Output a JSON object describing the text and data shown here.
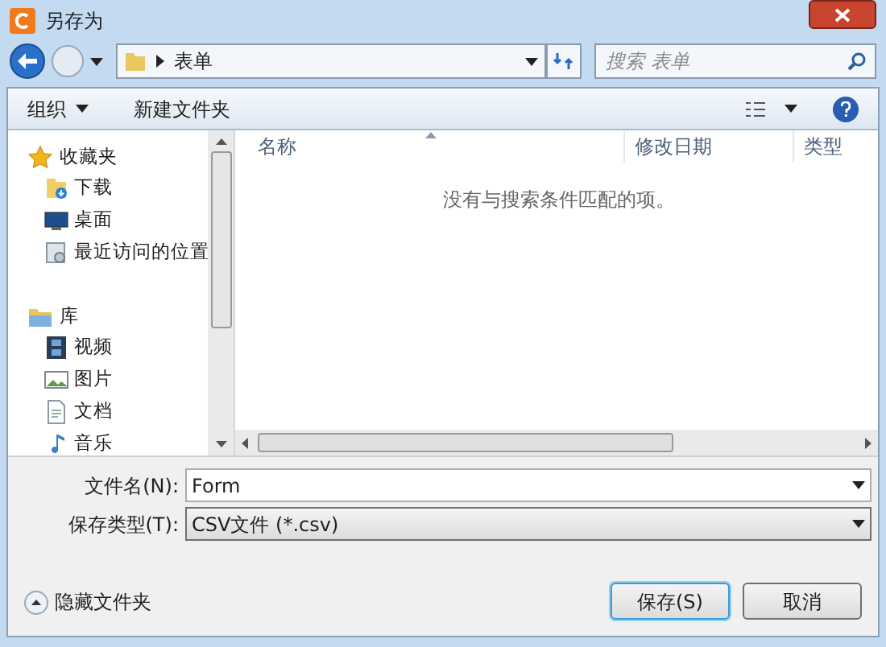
{
  "window": {
    "title": "另存为"
  },
  "address": {
    "path": "表单"
  },
  "search": {
    "placeholder": "搜索 表单"
  },
  "toolbar": {
    "organize": "组织",
    "new_folder": "新建文件夹"
  },
  "sidebar": {
    "groups": [
      {
        "label": "收藏夹",
        "kind": "favorites",
        "children": [
          {
            "label": "下载",
            "kind": "download"
          },
          {
            "label": "桌面",
            "kind": "desktop"
          },
          {
            "label": "最近访问的位置",
            "kind": "recent"
          }
        ]
      },
      {
        "label": "库",
        "kind": "library",
        "children": [
          {
            "label": "视频",
            "kind": "video"
          },
          {
            "label": "图片",
            "kind": "pictures"
          },
          {
            "label": "文档",
            "kind": "documents"
          },
          {
            "label": "音乐",
            "kind": "music"
          }
        ]
      }
    ]
  },
  "file_list": {
    "columns": [
      "名称",
      "修改日期",
      "类型"
    ],
    "empty_message": "没有与搜索条件匹配的项。"
  },
  "form": {
    "file_name": {
      "label": "文件名(N):",
      "value": "Form"
    },
    "file_type": {
      "label": "保存类型(T):",
      "value": "CSV文件 (*.csv)"
    }
  },
  "hide_folders": {
    "label": "隐藏文件夹"
  },
  "buttons": [
    {
      "label": "保存(S)",
      "default": true
    },
    {
      "label": "取消",
      "default": false
    }
  ]
}
